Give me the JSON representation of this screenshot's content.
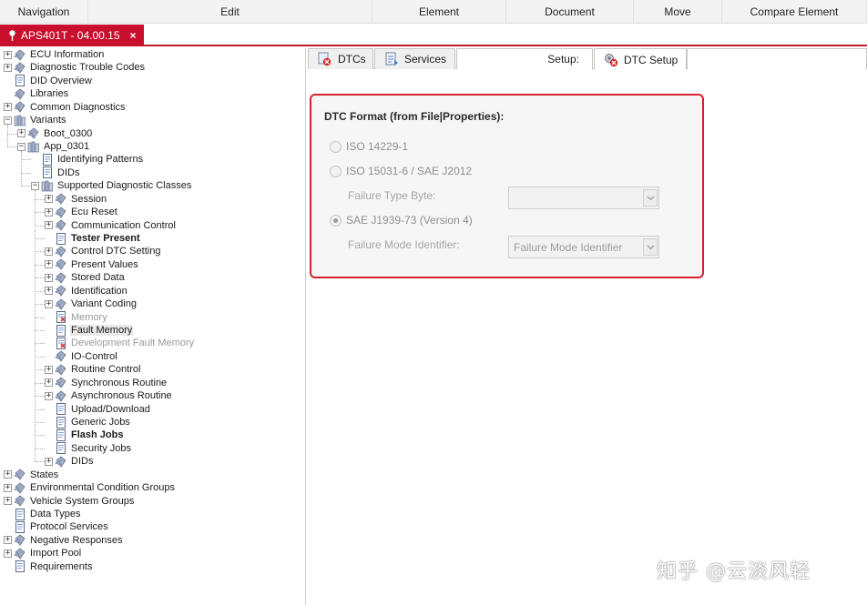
{
  "menubar": {
    "items": [
      {
        "label": "Navigation",
        "width": 97
      },
      {
        "label": "Edit",
        "width": 312
      },
      {
        "label": "Element",
        "width": 147
      },
      {
        "label": "Document",
        "width": 140
      },
      {
        "label": "Move",
        "width": 97
      },
      {
        "label": "Compare Element",
        "width": 159
      }
    ]
  },
  "document_tab": {
    "label": "APS401T - 04.00.15",
    "close": "×"
  },
  "tree": {
    "nodes": [
      {
        "label": "ECU Information",
        "level": 0,
        "exp": "+",
        "icon": "gem"
      },
      {
        "label": "Diagnostic Trouble Codes",
        "level": 0,
        "exp": "+",
        "icon": "gem"
      },
      {
        "label": "DID Overview",
        "level": 0,
        "exp": "",
        "icon": "doc"
      },
      {
        "label": "Libraries",
        "level": 0,
        "exp": "",
        "icon": "gem"
      },
      {
        "label": "Common Diagnostics",
        "level": 0,
        "exp": "+",
        "icon": "gem"
      },
      {
        "label": "Variants",
        "level": 0,
        "exp": "-",
        "icon": "books"
      },
      {
        "label": "Boot_0300",
        "level": 1,
        "exp": "+",
        "icon": "gem"
      },
      {
        "label": "App_0301",
        "level": 1,
        "exp": "-",
        "icon": "books"
      },
      {
        "label": "Identifying Patterns",
        "level": 2,
        "exp": "",
        "icon": "doc"
      },
      {
        "label": "DIDs",
        "level": 2,
        "exp": "",
        "icon": "doc"
      },
      {
        "label": "Supported Diagnostic Classes",
        "level": 2,
        "exp": "-",
        "icon": "books"
      },
      {
        "label": "Session",
        "level": 3,
        "exp": "+",
        "icon": "gem"
      },
      {
        "label": "Ecu Reset",
        "level": 3,
        "exp": "+",
        "icon": "gem"
      },
      {
        "label": "Communication Control",
        "level": 3,
        "exp": "+",
        "icon": "gem"
      },
      {
        "label": "Tester Present",
        "level": 3,
        "exp": "",
        "icon": "doc",
        "style": "bold"
      },
      {
        "label": "Control DTC Setting",
        "level": 3,
        "exp": "+",
        "icon": "gem"
      },
      {
        "label": "Present Values",
        "level": 3,
        "exp": "+",
        "icon": "gem"
      },
      {
        "label": "Stored Data",
        "level": 3,
        "exp": "+",
        "icon": "gem"
      },
      {
        "label": "Identification",
        "level": 3,
        "exp": "+",
        "icon": "gem"
      },
      {
        "label": "Variant Coding",
        "level": 3,
        "exp": "+",
        "icon": "gem"
      },
      {
        "label": "Memory",
        "level": 3,
        "exp": "",
        "icon": "doc-x",
        "style": "dim"
      },
      {
        "label": "Fault Memory",
        "level": 3,
        "exp": "",
        "icon": "doc",
        "style": "sel"
      },
      {
        "label": "Development Fault Memory",
        "level": 3,
        "exp": "",
        "icon": "doc-x",
        "style": "dim"
      },
      {
        "label": "IO-Control",
        "level": 3,
        "exp": "",
        "icon": "gem"
      },
      {
        "label": "Routine Control",
        "level": 3,
        "exp": "+",
        "icon": "gem"
      },
      {
        "label": "Synchronous Routine",
        "level": 3,
        "exp": "+",
        "icon": "gem"
      },
      {
        "label": "Asynchronous Routine",
        "level": 3,
        "exp": "+",
        "icon": "gem"
      },
      {
        "label": "Upload/Download",
        "level": 3,
        "exp": "",
        "icon": "doc"
      },
      {
        "label": "Generic Jobs",
        "level": 3,
        "exp": "",
        "icon": "doc"
      },
      {
        "label": "Flash Jobs",
        "level": 3,
        "exp": "",
        "icon": "doc",
        "style": "bold"
      },
      {
        "label": "Security Jobs",
        "level": 3,
        "exp": "",
        "icon": "doc"
      },
      {
        "label": "DIDs",
        "level": 3,
        "exp": "+",
        "icon": "gem"
      },
      {
        "label": "States",
        "level": 0,
        "exp": "+",
        "icon": "gem"
      },
      {
        "label": "Environmental Condition Groups",
        "level": 0,
        "exp": "+",
        "icon": "gem"
      },
      {
        "label": "Vehicle System Groups",
        "level": 0,
        "exp": "+",
        "icon": "gem"
      },
      {
        "label": "Data Types",
        "level": 0,
        "exp": "",
        "icon": "doc"
      },
      {
        "label": "Protocol Services",
        "level": 0,
        "exp": "",
        "icon": "doc"
      },
      {
        "label": "Negative Responses",
        "level": 0,
        "exp": "+",
        "icon": "gem"
      },
      {
        "label": "Import Pool",
        "level": 0,
        "exp": "+",
        "icon": "gem"
      },
      {
        "label": "Requirements",
        "level": 0,
        "exp": "",
        "icon": "doc"
      }
    ]
  },
  "panel_tabs": {
    "dtcs": "DTCs",
    "services": "Services",
    "setup_label": "Setup:",
    "dtc_setup": "DTC Setup"
  },
  "dtc_format": {
    "title": "DTC Format (from File|Properties):",
    "iso14229": "ISO 14229-1",
    "iso15031": "ISO 15031-6 / SAE J2012",
    "failure_type_byte_label": "Failure Type Byte:",
    "failure_type_byte_value": "",
    "saej1939": "SAE J1939-73 (Version 4)",
    "failure_mode_label": "Failure Mode Identifier:",
    "failure_mode_value": "Failure Mode Identifier",
    "selected": "saej1939"
  },
  "watermark": "知乎 @云淡风轻",
  "colors": {
    "accent": "#c8102e",
    "highlight_border": "#d8202a",
    "tree_icon": "#6f7f9f"
  }
}
